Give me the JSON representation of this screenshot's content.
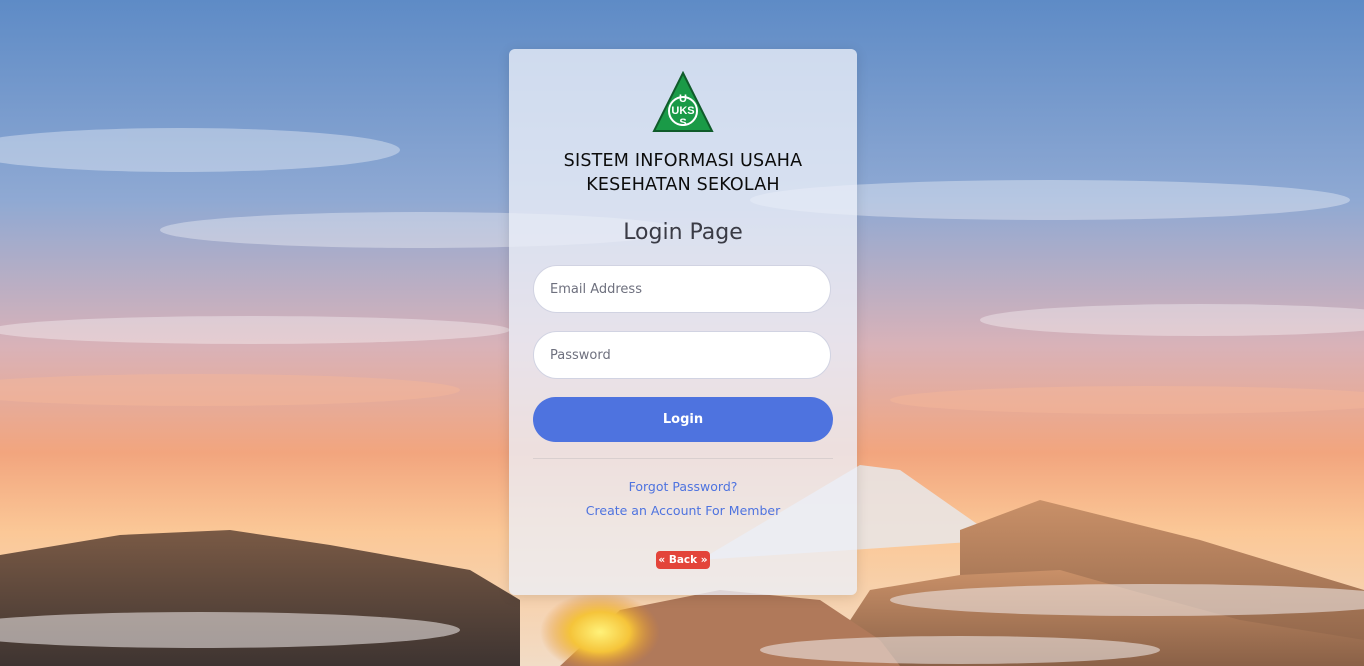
{
  "app": {
    "title_line1": "SISTEM INFORMASI USAHA",
    "title_line2": "KESEHATAN SEKOLAH",
    "logo": {
      "icon": "uks-triangle-logo",
      "letters": [
        "U",
        "KS",
        "S"
      ],
      "color": "#1a9a47"
    }
  },
  "login": {
    "heading": "Login Page",
    "email_placeholder": "Email Address",
    "password_placeholder": "Password",
    "login_label": "Login",
    "forgot_label": "Forgot Password?",
    "create_label": "Create an Account For Member",
    "back_label": "« Back »"
  },
  "colors": {
    "primary": "#4e73df",
    "danger": "#e3443a",
    "logo_green": "#1a9a47"
  }
}
